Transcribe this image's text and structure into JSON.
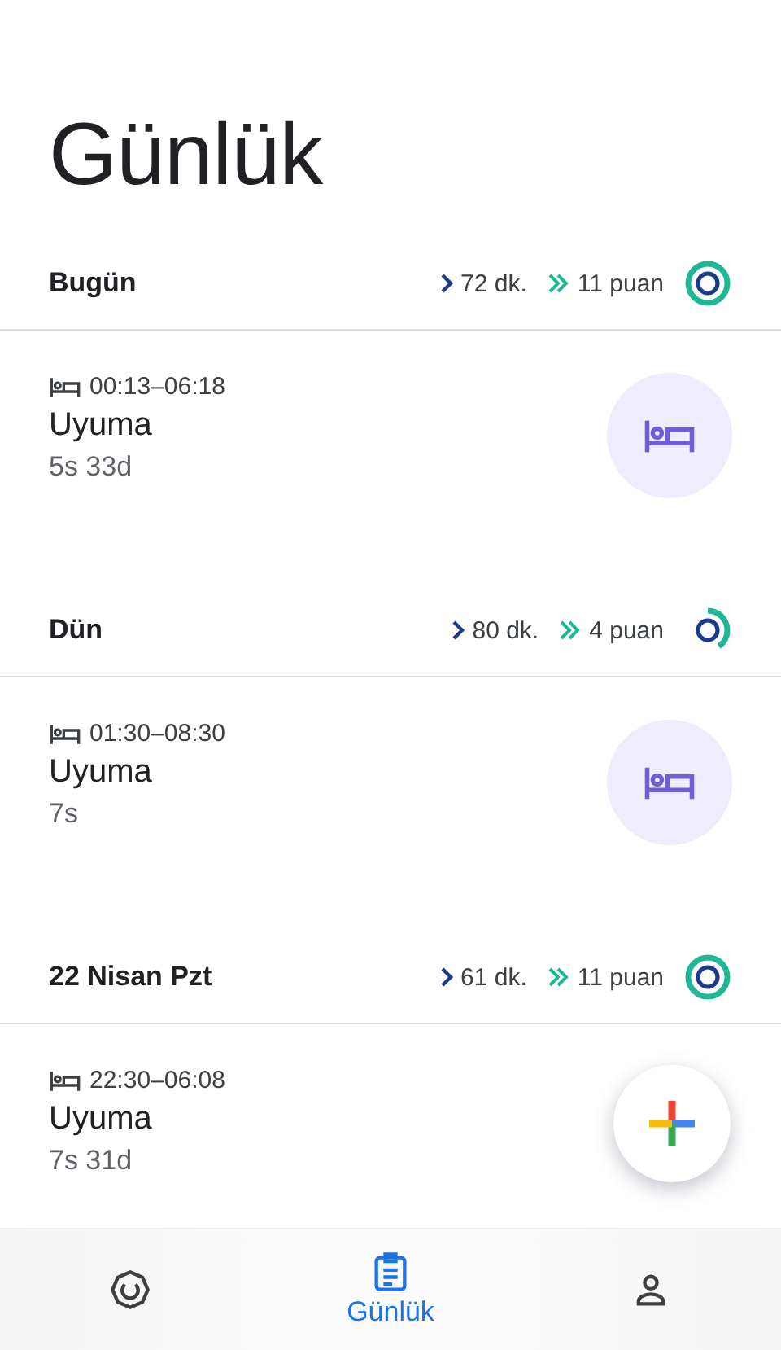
{
  "title": "Günlük",
  "days": [
    {
      "label": "Bugün",
      "minutes": "72 dk.",
      "points": "11 puan",
      "kind": "complete",
      "entries": [
        {
          "time": "00:13–06:18",
          "title": "Uyuma",
          "duration": "5s 33d",
          "icon_button": true
        }
      ]
    },
    {
      "label": "Dün",
      "minutes": "80 dk.",
      "points": "4 puan",
      "kind": "partial",
      "entries": [
        {
          "time": "01:30–08:30",
          "title": "Uyuma",
          "duration": "7s",
          "icon_button": true
        }
      ]
    },
    {
      "label": "22 Nisan Pzt",
      "minutes": "61 dk.",
      "points": "11 puan",
      "kind": "complete",
      "entries": [
        {
          "time": "22:30–06:08",
          "title": "Uyuma",
          "duration": "7s 31d"
        }
      ]
    }
  ],
  "nav": [
    {
      "kind": "rings",
      "selected": false
    },
    {
      "kind": "journal",
      "label": "Günlük",
      "selected": true
    },
    {
      "kind": "profile",
      "selected": false
    }
  ]
}
